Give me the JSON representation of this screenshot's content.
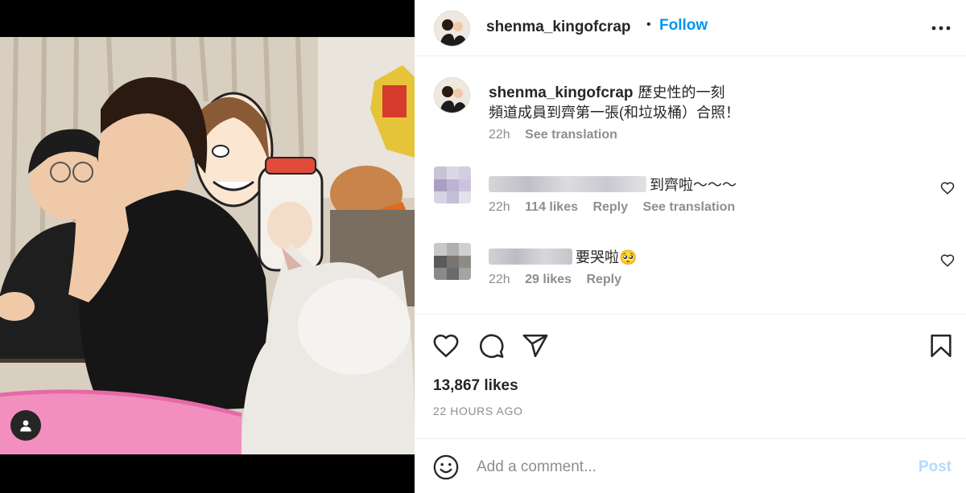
{
  "post": {
    "username": "shenma_kingofcrap",
    "separator": "•",
    "follow_label": "Follow",
    "caption_line1": "歷史性的一刻",
    "caption_line2": "頻道成員到齊第一張(和垃圾桶）合照！",
    "caption_time": "22h",
    "see_translation": "See translation",
    "likes": "13,867 likes",
    "posted_ago": "22 HOURS AGO"
  },
  "comments": [
    {
      "text": "到齊啦～～～",
      "time": "22h",
      "likes": "114 likes",
      "reply": "Reply",
      "see_translation": "See translation"
    },
    {
      "text": "要哭啦🥺",
      "time": "22h",
      "likes": "29 likes",
      "reply": "Reply"
    }
  ],
  "composer": {
    "placeholder": "Add a comment...",
    "post_label": "Post"
  },
  "icons": {
    "more": "more-options-icon",
    "like": "heart-icon",
    "comment": "comment-bubble-icon",
    "share": "paper-plane-icon",
    "save": "bookmark-icon",
    "emoji": "smiley-icon",
    "tag": "user-tag-icon"
  },
  "colors": {
    "accent": "#0095f6",
    "post_disabled": "#b3dbff",
    "muted": "#8e8e8e"
  }
}
